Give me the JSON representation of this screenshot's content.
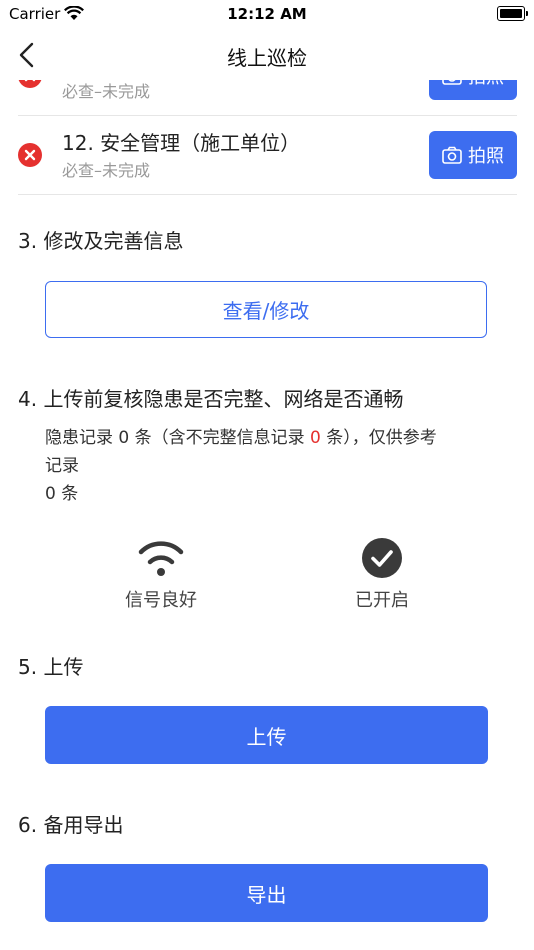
{
  "status_bar": {
    "carrier": "Carrier",
    "time": "12:12 AM"
  },
  "nav": {
    "title": "线上巡检"
  },
  "items": [
    {
      "title": "",
      "status": "必查–未完成",
      "button": "拍照"
    },
    {
      "title": "12. 安全管理（施工单位）",
      "status": "必查–未完成",
      "button": "拍照"
    }
  ],
  "section3": {
    "title": "3. 修改及完善信息",
    "button": "查看/修改"
  },
  "section4": {
    "title": "4. 上传前复核隐患是否完整、网络是否通畅",
    "line1_prefix": "隐患记录 0 条（含不完整信息记录 ",
    "line1_count": "0",
    "line1_suffix": " 条），仅供参考",
    "line2": "记录",
    "line3": "0 条",
    "signal_label": "信号良好",
    "enabled_label": "已开启"
  },
  "section5": {
    "title": "5. 上传",
    "button": "上传"
  },
  "section6": {
    "title": "6. 备用导出",
    "button": "导出"
  },
  "colors": {
    "accent": "#3d6df0",
    "danger": "#e5312f"
  },
  "icons": {
    "status": "close-circle-icon",
    "camera": "camera-icon",
    "wifi": "wifi-icon",
    "check": "check-circle-icon"
  }
}
